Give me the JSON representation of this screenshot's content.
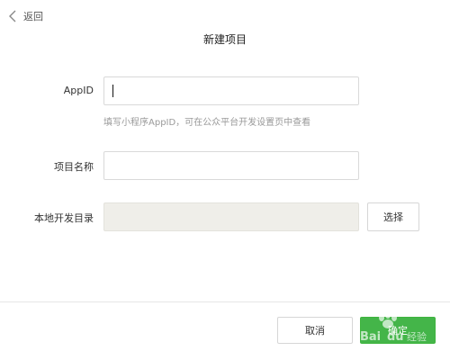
{
  "header": {
    "back_label": "返回",
    "title": "新建项目"
  },
  "form": {
    "appid": {
      "label": "AppID",
      "value": "",
      "hint": "填写小程序AppID，可在公众平台开发设置页中查看"
    },
    "project_name": {
      "label": "项目名称",
      "value": ""
    },
    "local_dir": {
      "label": "本地开发目录",
      "value": "",
      "choose_label": "选择"
    }
  },
  "footer": {
    "cancel_label": "取消",
    "confirm_label": "确定"
  },
  "watermark": {
    "text": "Bai du 经验"
  },
  "colors": {
    "accent": "#44b549",
    "disabled_field": "#efeee9"
  }
}
